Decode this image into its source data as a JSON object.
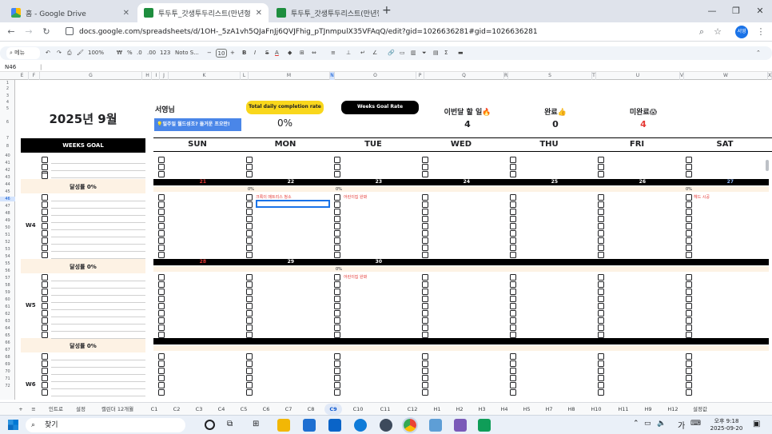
{
  "browser": {
    "tabs": [
      {
        "label": "홈 - Google Drive"
      },
      {
        "label": "투두투_갓생투두리스트(만년형"
      },
      {
        "label": "투두투_갓생투두리스트(만년형"
      }
    ],
    "new_tab": "+",
    "url": "docs.google.com/spreadsheets/d/1OH-_5zA1vh5QJaFnJj6QVJFhig_pTJnmpulX35VFAqQ/edit?gid=1026636281#gid=1026636281",
    "profile": "서영"
  },
  "toolbar": {
    "search": "메뉴",
    "zoom": "100%",
    "currency": "₩",
    "percent": "%",
    "decimal_dec": ".0",
    "decimal_inc": ".00",
    "number_format": "123",
    "font": "Noto S...",
    "font_size": "10",
    "bold": "B",
    "italic": "I",
    "strike": "S",
    "text_color": "A"
  },
  "name_box": "N46",
  "sheet": {
    "month_title": "2025년 9월",
    "weeks_goal_header": "WEEKS GOAL",
    "user_label": "서영님",
    "banner_text": "💡일주일 월드성조? 들거운 프오만!",
    "total_rate_label": "Total daily completion rate",
    "total_rate_value": "0%",
    "weeks_goal_rate_label": "Weeks Goal Rate",
    "todo_label": "이번달 할 일🔥",
    "todo_count": "4",
    "done_label": "완료👍",
    "done_count": "0",
    "undone_label": "미완료😱",
    "undone_count": "4",
    "days": [
      "SUN",
      "MON",
      "TUE",
      "WED",
      "THU",
      "FRI",
      "SAT"
    ],
    "week4": {
      "label": "W4",
      "achievement": "달성률 0%",
      "dates": [
        "21",
        "22",
        "23",
        "24",
        "25",
        "26",
        "27"
      ],
      "mon_pct": "0%",
      "tue_pct": "0%",
      "sat_pct": "0%",
      "mon_task": "크록이 매트리스 청소",
      "tue_task": "어린이집 완봐",
      "sat_task": "헤드 시공"
    },
    "week5": {
      "label": "W5",
      "achievement": "달성률 0%",
      "dates": [
        "28",
        "29",
        "30"
      ],
      "tue_pct": "0%",
      "tue_task": "어린이집 완봐"
    },
    "week6": {
      "label": "W6",
      "achievement": "달성률 0%"
    },
    "col_headers": [
      "E",
      "F",
      "G",
      "H",
      "I",
      "J",
      "K",
      "L",
      "M",
      "N",
      "O",
      "P",
      "Q",
      "R",
      "S",
      "T",
      "U",
      "V",
      "W",
      "X"
    ],
    "row_numbers": [
      "1",
      "2",
      "3",
      "4",
      "5",
      "6",
      "7",
      "8",
      "40",
      "41",
      "42",
      "43",
      "44",
      "45",
      "46",
      "47",
      "48",
      "49",
      "50",
      "51",
      "52",
      "53",
      "54",
      "55",
      "56",
      "57",
      "58",
      "59",
      "60",
      "61",
      "62",
      "63",
      "64",
      "65",
      "66",
      "67",
      "68",
      "69",
      "70",
      "71",
      "72"
    ]
  },
  "sheet_tabs": [
    "인트로",
    "설정",
    "캘린더 12개월",
    "C1",
    "C2",
    "C3",
    "C4",
    "C5",
    "C6",
    "C7",
    "C8",
    "C9",
    "C10",
    "C11",
    "C12",
    "H1",
    "H2",
    "H3",
    "H4",
    "H5",
    "H7",
    "H8",
    "H10",
    "H11",
    "H9",
    "H12",
    "설정값"
  ],
  "active_sheet": "C9",
  "taskbar": {
    "search": "찾기",
    "time": "오후 9:18",
    "date": "2025-09-20",
    "ime": "가"
  },
  "colors": {
    "accent_yellow": "#f9d71c",
    "black_bar": "#000000",
    "beige": "#fdf2e4",
    "red": "#e53935",
    "blue_banner": "#4a86e8"
  }
}
